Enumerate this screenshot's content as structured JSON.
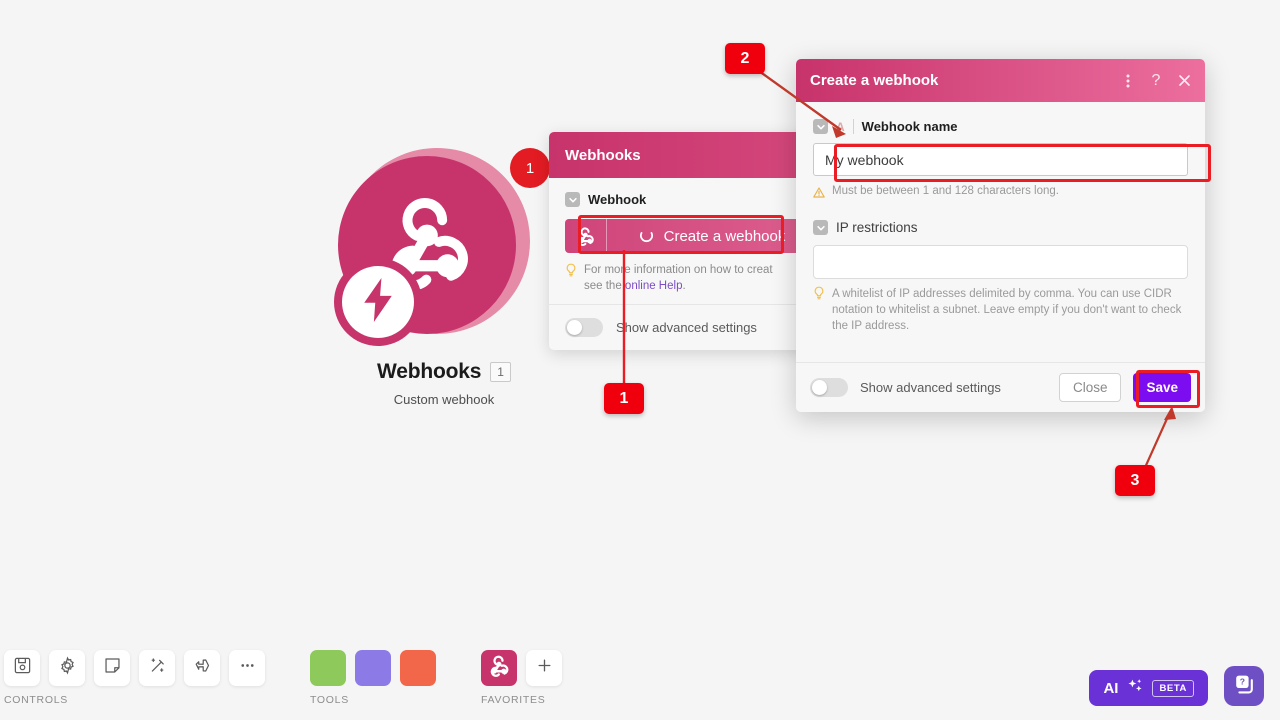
{
  "module": {
    "icon": "webhooks-icon",
    "badge_icon": "lightning-bolt-icon",
    "badge_number": "1",
    "title": "Webhooks",
    "count": "1",
    "subtitle": "Custom webhook",
    "color": "#c7336b"
  },
  "webhooks_panel": {
    "header_title": "Webhooks",
    "field_label": "Webhook",
    "create_button_label": "Create a webhook",
    "hint_prefix": "For more information on how to creat",
    "hint_line2_prefix": "see the ",
    "hint_link": "online Help",
    "hint_suffix": ".",
    "advanced_toggle_label": "Show advanced settings"
  },
  "create_dialog": {
    "title": "Create a webhook",
    "header_icons": [
      "kebab-menu-icon",
      "help-icon",
      "close-icon"
    ],
    "required_marker": "A",
    "name_label": "Webhook name",
    "name_value": "My webhook",
    "name_placeholder": "",
    "name_message": "Must be between 1 and 128 characters long.",
    "ip_label": "IP restrictions",
    "ip_value": "",
    "ip_placeholder": "",
    "ip_message": "A whitelist of IP addresses delimited by comma. You can use CIDR notation to whitelist a subnet. Leave empty if you don't want to check the IP address.",
    "advanced_toggle_label": "Show advanced settings",
    "close_label": "Close",
    "save_label": "Save",
    "save_color": "#7b0df0"
  },
  "annotations": {
    "accent_color": "#ea1c24",
    "steps": [
      {
        "number": "1",
        "target": "create-a-webhook-button"
      },
      {
        "number": "2",
        "target": "webhook-name-input"
      },
      {
        "number": "3",
        "target": "save-button"
      }
    ]
  },
  "bottom_bar": {
    "controls": {
      "caption": "CONTROLS",
      "items": [
        {
          "icon": "save-disk-icon"
        },
        {
          "icon": "gear-icon"
        },
        {
          "icon": "note-icon"
        },
        {
          "icon": "magic-wand-icon"
        },
        {
          "icon": "airplane-icon"
        },
        {
          "icon": "ellipsis-icon"
        }
      ]
    },
    "tools": {
      "caption": "TOOLS",
      "items": [
        {
          "icon": "gear-icon",
          "color": "#8ec95c"
        },
        {
          "icon": "tools-icon",
          "color": "#8c7ae6"
        },
        {
          "icon": "brackets-icon",
          "color": "#f2664a"
        }
      ]
    },
    "favorites": {
      "caption": "FAVORITES",
      "items": [
        {
          "icon": "webhooks-icon",
          "color": "#c7336b"
        },
        {
          "icon": "plus-icon",
          "color": "#ffffff"
        }
      ]
    },
    "ai_button": {
      "label": "AI",
      "badge": "BETA",
      "icon": "sparkles-icon",
      "color": "#6a31d6"
    },
    "help_button": {
      "icon": "help-docs-icon",
      "color": "#6f4fc4"
    }
  }
}
